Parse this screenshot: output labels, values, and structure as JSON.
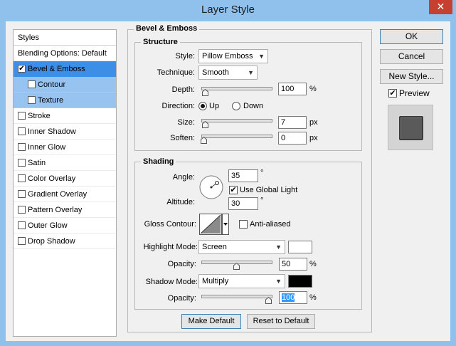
{
  "window": {
    "title": "Layer Style",
    "close_glyph": "✕"
  },
  "styles_panel": {
    "header": "Styles",
    "blending_options": "Blending Options: Default",
    "items": [
      {
        "label": "Bevel & Emboss",
        "checked": true,
        "selected": true,
        "sub": false
      },
      {
        "label": "Contour",
        "checked": false,
        "selected": false,
        "sub": true
      },
      {
        "label": "Texture",
        "checked": false,
        "selected": false,
        "sub": true
      },
      {
        "label": "Stroke",
        "checked": false
      },
      {
        "label": "Inner Shadow",
        "checked": false
      },
      {
        "label": "Inner Glow",
        "checked": false
      },
      {
        "label": "Satin",
        "checked": false
      },
      {
        "label": "Color Overlay",
        "checked": false
      },
      {
        "label": "Gradient Overlay",
        "checked": false
      },
      {
        "label": "Pattern Overlay",
        "checked": false
      },
      {
        "label": "Outer Glow",
        "checked": false
      },
      {
        "label": "Drop Shadow",
        "checked": false
      }
    ]
  },
  "bevel_emboss": {
    "title": "Bevel & Emboss",
    "structure": {
      "title": "Structure",
      "style_label": "Style:",
      "style_value": "Pillow Emboss",
      "technique_label": "Technique:",
      "technique_value": "Smooth",
      "depth_label": "Depth:",
      "depth_value": "100",
      "depth_unit": "%",
      "direction_label": "Direction:",
      "direction_up": "Up",
      "direction_down": "Down",
      "direction_selected": "Up",
      "size_label": "Size:",
      "size_value": "7",
      "size_unit": "px",
      "soften_label": "Soften:",
      "soften_value": "0",
      "soften_unit": "px"
    },
    "shading": {
      "title": "Shading",
      "angle_label": "Angle:",
      "angle_value": "35",
      "angle_unit": "°",
      "use_global_light_label": "Use Global Light",
      "use_global_light_checked": true,
      "altitude_label": "Altitude:",
      "altitude_value": "30",
      "altitude_unit": "°",
      "gloss_contour_label": "Gloss Contour:",
      "anti_aliased_label": "Anti-aliased",
      "anti_aliased_checked": false,
      "highlight_mode_label": "Highlight Mode:",
      "highlight_mode_value": "Screen",
      "highlight_color": "#ffffff",
      "highlight_opacity_label": "Opacity:",
      "highlight_opacity_value": "50",
      "highlight_opacity_unit": "%",
      "shadow_mode_label": "Shadow Mode:",
      "shadow_mode_value": "Multiply",
      "shadow_color": "#000000",
      "shadow_opacity_label": "Opacity:",
      "shadow_opacity_value": "100",
      "shadow_opacity_unit": "%"
    },
    "make_default_label": "Make Default",
    "reset_default_label": "Reset to Default"
  },
  "slider_levels": {
    "depth": 0.02,
    "size": 0.02,
    "soften": 0.0,
    "highlight_opacity": 0.5,
    "shadow_opacity": 1.0
  },
  "actions": {
    "ok_label": "OK",
    "cancel_label": "Cancel",
    "new_style_label": "New Style...",
    "preview_label": "Preview",
    "preview_checked": true
  },
  "colors": {
    "title_bar": "#8fc1ec",
    "selection": "#3d8ee6",
    "sub_selection": "#97c3f0",
    "close_button": "#c7402f"
  }
}
